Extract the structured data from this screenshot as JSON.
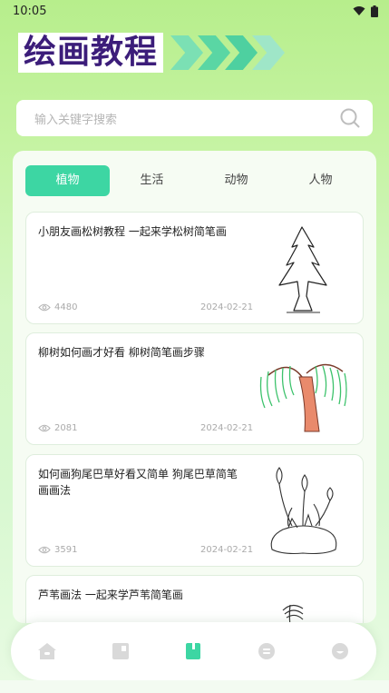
{
  "status_bar": {
    "time": "10:05",
    "icons": [
      "wifi-icon",
      "battery-icon"
    ]
  },
  "header": {
    "title": "绘画教程",
    "arrow_colors": [
      "#7be0b4",
      "#5ad6a4",
      "#4ed0a0"
    ]
  },
  "search": {
    "placeholder": "输入关键字搜索",
    "icon": "search-icon"
  },
  "tabs": [
    {
      "label": "植物",
      "active": true
    },
    {
      "label": "生活",
      "active": false
    },
    {
      "label": "动物",
      "active": false
    },
    {
      "label": "人物",
      "active": false
    }
  ],
  "cards": [
    {
      "title": "小朋友画松树教程 一起来学松树简笔画",
      "views": "4480",
      "date": "2024-02-21",
      "thumb": "pine-tree"
    },
    {
      "title": "柳树如何画才好看 柳树简笔画步骤",
      "views": "2081",
      "date": "2024-02-21",
      "thumb": "willow-tree"
    },
    {
      "title": "如何画狗尾巴草好看又简单 狗尾巴草简笔画画法",
      "views": "3591",
      "date": "2024-02-21",
      "thumb": "foxtail-grass"
    },
    {
      "title": "芦苇画法 一起来学芦苇简笔画",
      "views": "",
      "date": "",
      "thumb": "reed"
    }
  ],
  "bottom_nav": [
    {
      "icon": "home-icon",
      "active": false
    },
    {
      "icon": "gallery-icon",
      "active": false
    },
    {
      "icon": "book-icon",
      "active": true
    },
    {
      "icon": "message-icon",
      "active": false
    },
    {
      "icon": "profile-icon",
      "active": false
    }
  ],
  "colors": {
    "accent": "#3dd6a3",
    "title_text": "#3c1d7a",
    "inactive_icon": "#d6d6d6"
  }
}
